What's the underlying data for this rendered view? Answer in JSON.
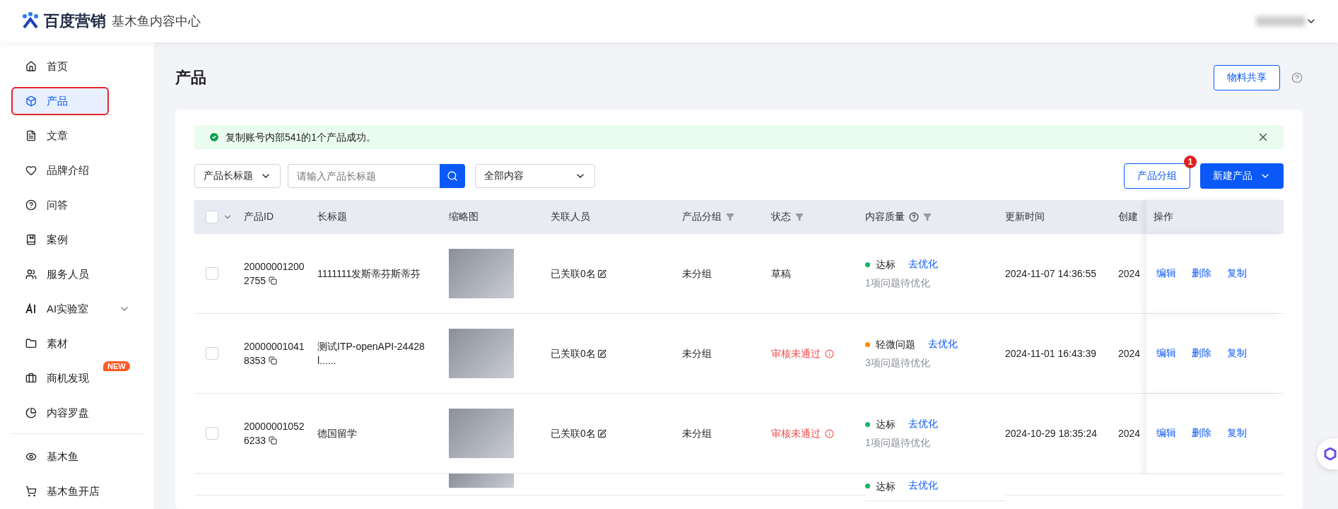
{
  "header": {
    "brand": "百度营销",
    "product": "基木鱼内容中心"
  },
  "sidebar": {
    "sections": [
      [
        {
          "label": "首页",
          "selected": false,
          "outlined": false
        },
        {
          "label": "产品",
          "selected": true,
          "outlined": true
        },
        {
          "label": "文章",
          "selected": false,
          "outlined": false
        },
        {
          "label": "品牌介绍",
          "selected": false,
          "outlined": false
        },
        {
          "label": "问答",
          "selected": false,
          "outlined": false
        },
        {
          "label": "案例",
          "selected": false,
          "outlined": false
        },
        {
          "label": "服务人员",
          "selected": false,
          "outlined": false
        },
        {
          "label": "AI实验室",
          "selected": false,
          "outlined": false,
          "expanded": false
        },
        {
          "label": "素材",
          "selected": false,
          "outlined": false
        },
        {
          "label": "商机发现",
          "selected": false,
          "outlined": false,
          "badge": "NEW"
        },
        {
          "label": "内容罗盘",
          "selected": false,
          "outlined": false
        }
      ],
      [
        {
          "label": "基木鱼",
          "selected": false,
          "outlined": false
        },
        {
          "label": "基木鱼开店",
          "selected": false,
          "outlined": false
        }
      ]
    ]
  },
  "page": {
    "title": "产品",
    "share_button": "物料共享"
  },
  "alert": {
    "message": "复制账号内部541的1个产品成功。"
  },
  "toolbar": {
    "field_select": "产品长标题",
    "search": {
      "placeholder": "请输入产品长标题"
    },
    "content_select": "全部内容",
    "group_button": "产品分组",
    "group_badge": "1",
    "new_button": "新建产品"
  },
  "table": {
    "select_all": {
      "checked": false
    },
    "columns": [
      {
        "label": "产品ID"
      },
      {
        "label": "长标题"
      },
      {
        "label": "缩略图"
      },
      {
        "label": "关联人员"
      },
      {
        "label": "产品分组",
        "filter": true
      },
      {
        "label": "状态",
        "filter": true
      },
      {
        "label": "内容质量",
        "filter": true,
        "help": true
      },
      {
        "label": "更新时间"
      },
      {
        "label": "创建"
      },
      {
        "label": "操作"
      }
    ],
    "rows": [
      {
        "checked": false,
        "id": "200000012002755",
        "title": "1111111发斯蒂芬斯蒂芬",
        "people": "已关联0名",
        "group": "未分组",
        "status": {
          "kind": "draft",
          "text": "草稿"
        },
        "quality": {
          "color": "#12b76a",
          "label": "达标",
          "link": "去优化",
          "note": "1项问题待优化"
        },
        "updated": "2024-11-07 14:36:55",
        "created": "2024",
        "actions": [
          "编辑",
          "删除",
          "复制"
        ]
      },
      {
        "checked": false,
        "id": "200000010418353",
        "title": "测试ITP-openAPI-24428l......",
        "people": "已关联0名",
        "group": "未分组",
        "status": {
          "kind": "rejected",
          "text": "审核未通过"
        },
        "quality": {
          "color": "#ff8a00",
          "label": "轻微问题",
          "link": "去优化",
          "note": "3项问题待优化"
        },
        "updated": "2024-11-01 16:43:39",
        "created": "2024",
        "actions": [
          "编辑",
          "删除",
          "复制"
        ]
      },
      {
        "checked": false,
        "id": "200000010526233",
        "title": "德国留学",
        "people": "已关联0名",
        "group": "未分组",
        "status": {
          "kind": "rejected",
          "text": "审核未通过"
        },
        "quality": {
          "color": "#12b76a",
          "label": "达标",
          "link": "去优化",
          "note": "1项问题待优化"
        },
        "updated": "2024-10-29 18:35:24",
        "created": "2024",
        "actions": [
          "编辑",
          "删除",
          "复制"
        ]
      }
    ],
    "partial_row": {
      "quality": {
        "color": "#12b76a",
        "label": "达标",
        "link": "去优化"
      }
    }
  }
}
